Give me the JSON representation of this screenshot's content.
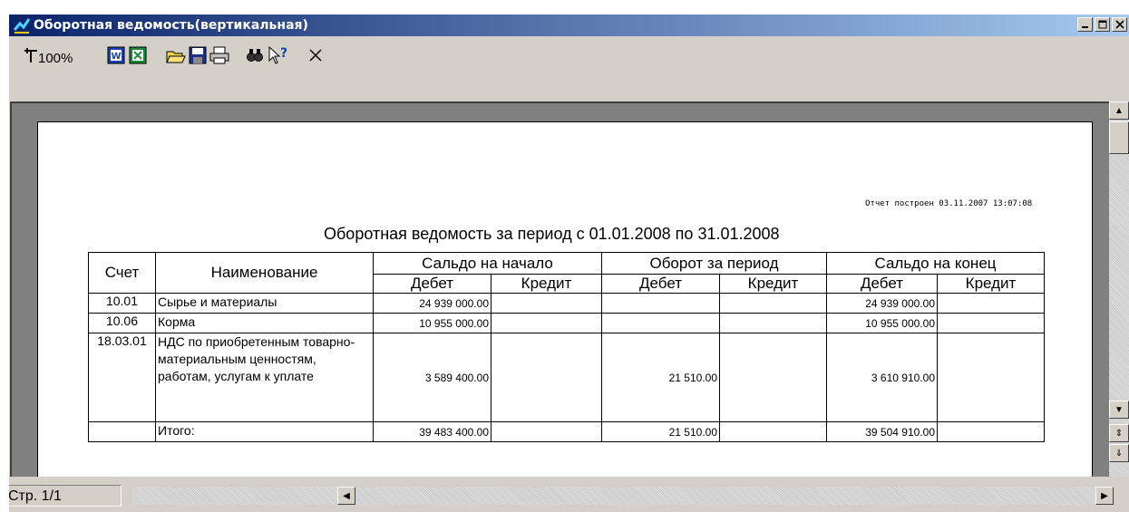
{
  "window": {
    "title": "Оборотная ведомость(вертикальная)"
  },
  "toolbar": {
    "zoom_label": "100%",
    "icons": [
      "zoom-tool-icon",
      "word-export-icon",
      "excel-export-icon",
      "open-folder-icon",
      "save-icon",
      "print-icon",
      "find-icon",
      "help-pointer-icon",
      "close-icon"
    ]
  },
  "report": {
    "built_label": "Отчет построен 03.11.2007 13:07:08",
    "title": "Оборотная ведомость за период с 01.01.2008 по 31.01.2008",
    "headers": {
      "account": "Счет",
      "name": "Наименование",
      "opening": "Сальдо на начало",
      "turnover": "Оборот за период",
      "closing": "Сальдо на конец",
      "debit": "Дебет",
      "credit": "Кредит"
    },
    "rows": [
      {
        "account": "10.01",
        "name": "Сырье и материалы",
        "open_debit": "24 939 000.00",
        "open_credit": "",
        "turn_debit": "",
        "turn_credit": "",
        "close_debit": "24 939 000.00",
        "close_credit": ""
      },
      {
        "account": "10.06",
        "name": "Корма",
        "open_debit": "10 955 000.00",
        "open_credit": "",
        "turn_debit": "",
        "turn_credit": "",
        "close_debit": "10 955 000.00",
        "close_credit": ""
      },
      {
        "account": "18.03.01",
        "name": "НДС по приобретенным товарно-материальным ценностям, работам, услугам к уплате",
        "open_debit": "3 589 400.00",
        "open_credit": "",
        "turn_debit": "21 510.00",
        "turn_credit": "",
        "close_debit": "3 610 910.00",
        "close_credit": ""
      }
    ],
    "total": {
      "account": "",
      "name": "Итого:",
      "open_debit": "39 483 400.00",
      "open_credit": "",
      "turn_debit": "21 510.00",
      "turn_credit": "",
      "close_debit": "39 504 910.00",
      "close_credit": ""
    }
  },
  "status": {
    "page": "Стр. 1/1"
  },
  "colors": {
    "titlebar_start": "#0a246a",
    "titlebar_end": "#a6caf0",
    "chrome": "#d4d0c8",
    "workspace": "#808080"
  }
}
